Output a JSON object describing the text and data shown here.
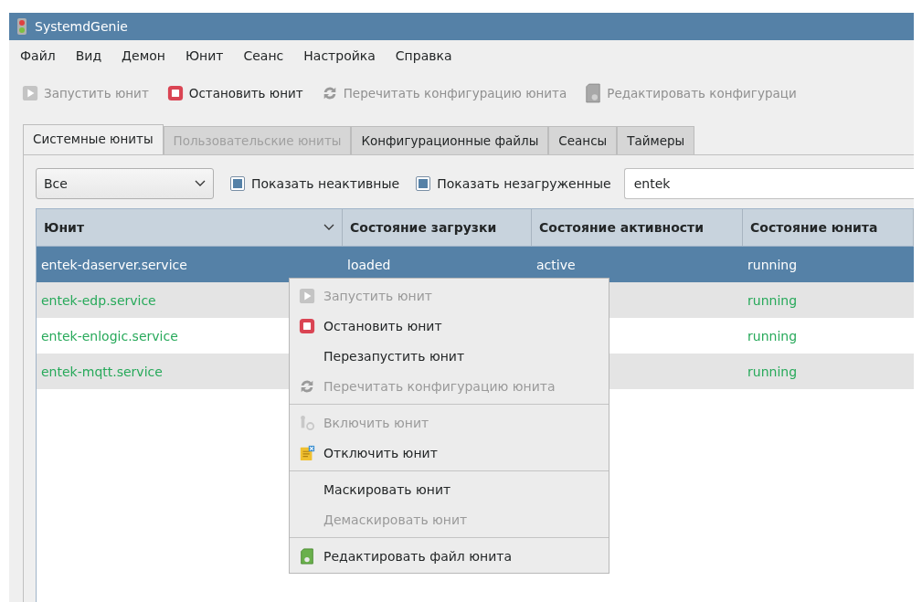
{
  "window": {
    "title": "SystemdGenie"
  },
  "menu_bar": [
    "Файл",
    "Вид",
    "Демон",
    "Юнит",
    "Сеанс",
    "Настройка",
    "Справка"
  ],
  "toolbar": [
    {
      "label": "Запустить юнит",
      "kind": "play",
      "disabled": true
    },
    {
      "label": "Остановить юнит",
      "kind": "stop",
      "disabled": false
    },
    {
      "label": "Перечитать конфигурацию юнита",
      "kind": "reload",
      "disabled": true
    },
    {
      "label": "Редактировать конфигураци",
      "kind": "file",
      "disabled": true
    }
  ],
  "tabs": [
    {
      "label": "Системные юниты",
      "selected": true,
      "disabled": false
    },
    {
      "label": "Пользовательские юниты",
      "selected": false,
      "disabled": true
    },
    {
      "label": "Конфигурационные файлы",
      "selected": false,
      "disabled": false
    },
    {
      "label": "Сеансы",
      "selected": false,
      "disabled": false
    },
    {
      "label": "Таймеры",
      "selected": false,
      "disabled": false
    }
  ],
  "filter": {
    "value": "Все"
  },
  "checkboxes": [
    {
      "label": "Показать неактивные",
      "checked": true
    },
    {
      "label": "Показать незагруженные",
      "checked": true
    }
  ],
  "search": {
    "value": "entek"
  },
  "table": {
    "columns": [
      "Юнит",
      "Состояние загрузки",
      "Состояние активности",
      "Состояние юнита"
    ],
    "rows": [
      {
        "selected": true,
        "cells": [
          "entek-daserver.service",
          "loaded",
          "active",
          "running"
        ]
      },
      {
        "selected": false,
        "cells": [
          "entek-edp.service",
          "",
          "",
          "running"
        ]
      },
      {
        "selected": false,
        "cells": [
          "entek-enlogic.service",
          "",
          "",
          "running"
        ]
      },
      {
        "selected": false,
        "cells": [
          "entek-mqtt.service",
          "",
          "",
          "running"
        ]
      }
    ]
  },
  "context_menu": [
    [
      {
        "label": "Запустить юнит",
        "kind": "play",
        "disabled": true
      },
      {
        "label": "Остановить юнит",
        "kind": "stop",
        "disabled": false
      },
      {
        "label": "Перезапустить юнит",
        "kind": "plain",
        "disabled": false
      },
      {
        "label": "Перечитать конфигурацию юнита",
        "kind": "reload",
        "disabled": true
      }
    ],
    [
      {
        "label": "Включить юнит",
        "kind": "enable",
        "disabled": true
      },
      {
        "label": "Отключить юнит",
        "kind": "disable",
        "disabled": false
      }
    ],
    [
      {
        "label": "Маскировать юнит",
        "kind": "plain",
        "disabled": false
      },
      {
        "label": "Демаскировать юнит",
        "kind": "plain",
        "disabled": true
      }
    ],
    [
      {
        "label": "Редактировать файл юнита",
        "kind": "edit",
        "disabled": false
      }
    ]
  ]
}
